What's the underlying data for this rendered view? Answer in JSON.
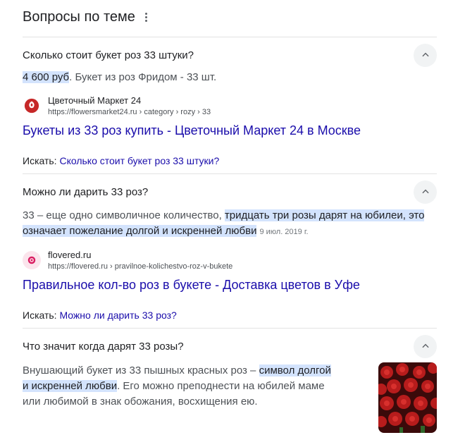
{
  "header": {
    "title": "Вопросы по теме",
    "menu_icon": "more-vert-icon"
  },
  "qa": [
    {
      "question": "Сколько стоит букет роз 33 штуки?",
      "answer_highlight": "4 600 руб",
      "answer_rest": ". Букет из роз Фридом - 33 шт.",
      "source_name": "Цветочный Маркет 24",
      "source_url": "https://flowersmarket24.ru › category › rozy › 33",
      "result_title": "Букеты из 33 роз купить - Цветочный Маркет 24 в Москве",
      "search_label": "Искать:",
      "search_link": "Сколько стоит букет роз 33 штуки?"
    },
    {
      "question": "Можно ли дарить 33 роз?",
      "answer_plain": "33 – еще одно символичное количество, ",
      "answer_highlight": "тридцать три розы дарят на юбилеи, это означает пожелание долгой и искренней любви",
      "answer_date": "9 июл. 2019 г.",
      "source_name": "flovered.ru",
      "source_url": "https://flovered.ru › pravilnoe-kolichestvo-roz-v-bukete",
      "result_title": "Правильное кол-во роз в букете - Доставка цветов в Уфе",
      "search_label": "Искать:",
      "search_link": "Можно ли дарить 33 роз?"
    },
    {
      "question": "Что значит когда дарят 33 розы?",
      "answer_plain": "Внушающий букет из 33 пышных красных роз – ",
      "answer_highlight": "символ долгой и искренней любви",
      "answer_rest": ". Его можно преподнести на юбилей маме или любимой в знак обожания, восхищения ею."
    }
  ],
  "colors": {
    "link": "#1a0dab",
    "highlight": "#d3e3fd",
    "divider": "#e3e3e3"
  }
}
